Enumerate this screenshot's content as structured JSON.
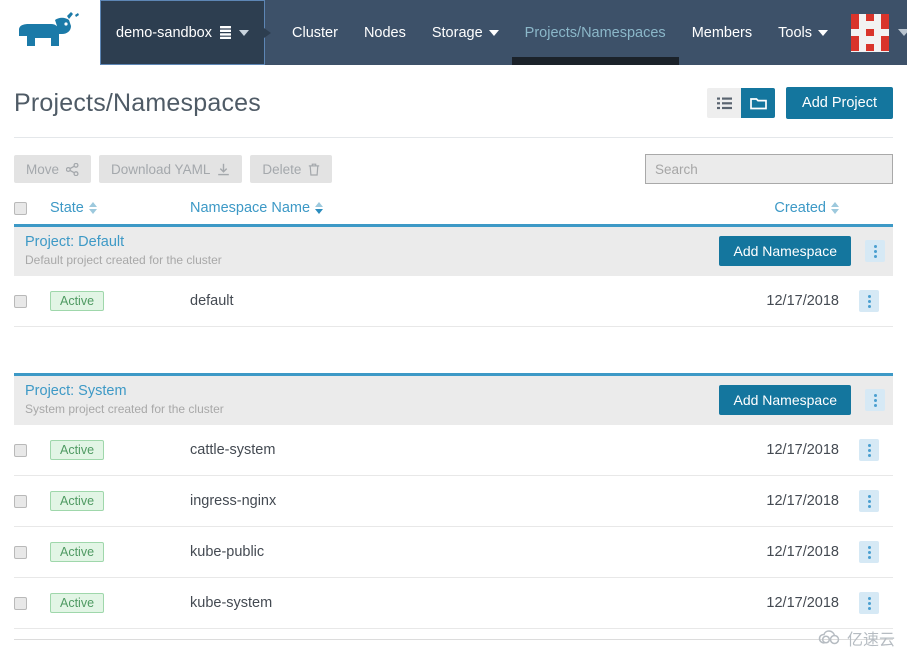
{
  "navbar": {
    "logo_name": "rancher-cow-logo",
    "cluster_selector": {
      "name": "demo-sandbox",
      "icon": "stack-icon",
      "caret": "chevron-down-icon"
    },
    "links": [
      {
        "label": "Cluster",
        "active": false,
        "has_caret": false
      },
      {
        "label": "Nodes",
        "active": false,
        "has_caret": false
      },
      {
        "label": "Storage",
        "active": false,
        "has_caret": true
      },
      {
        "label": "Projects/Namespaces",
        "active": true,
        "has_caret": false
      },
      {
        "label": "Members",
        "active": false,
        "has_caret": false
      },
      {
        "label": "Tools",
        "active": false,
        "has_caret": true
      }
    ],
    "avatar": {
      "name": "user-avatar",
      "caret": "chevron-down-icon"
    }
  },
  "page": {
    "title": "Projects/Namespaces",
    "view_toggles": [
      {
        "label": "list-view",
        "icon": "list-icon",
        "active": false
      },
      {
        "label": "group-view",
        "icon": "folder-icon",
        "active": true
      }
    ],
    "add_project_label": "Add Project"
  },
  "action_bar": {
    "buttons": [
      {
        "label": "Move",
        "icon": "share-icon",
        "disabled": true
      },
      {
        "label": "Download YAML",
        "icon": "download-icon",
        "disabled": true
      },
      {
        "label": "Delete",
        "icon": "trash-icon",
        "disabled": true
      }
    ],
    "search": {
      "value": "",
      "placeholder": "Search"
    }
  },
  "table": {
    "columns": [
      {
        "key": "state",
        "label": "State",
        "sortable": true,
        "sort_active": false
      },
      {
        "key": "name",
        "label": "Namespace Name",
        "sortable": true,
        "sort_active": true
      },
      {
        "key": "created",
        "label": "Created",
        "sortable": true,
        "sort_active": false
      }
    ],
    "groups": [
      {
        "title": "Project: Default",
        "description": "Default project created for the cluster",
        "action_label": "Add Namespace",
        "rows": [
          {
            "state": "Active",
            "name": "default",
            "created": "12/17/2018"
          }
        ]
      },
      {
        "title": "Project: System",
        "description": "System project created for the cluster",
        "action_label": "Add Namespace",
        "rows": [
          {
            "state": "Active",
            "name": "cattle-system",
            "created": "12/17/2018"
          },
          {
            "state": "Active",
            "name": "ingress-nginx",
            "created": "12/17/2018"
          },
          {
            "state": "Active",
            "name": "kube-public",
            "created": "12/17/2018"
          },
          {
            "state": "Active",
            "name": "kube-system",
            "created": "12/17/2018"
          }
        ]
      }
    ]
  },
  "watermark": {
    "text": "亿速云",
    "icon": "cloud-icon"
  },
  "colors": {
    "nav_bg": "#3d5169",
    "nav_selector_bg": "#2d3e50",
    "accent_blue": "#14769e",
    "link_blue": "#3d99c6",
    "badge_green_bg": "#e2f5e5",
    "badge_green_text": "#4f9a62",
    "avatar_red": "#d9342b"
  }
}
